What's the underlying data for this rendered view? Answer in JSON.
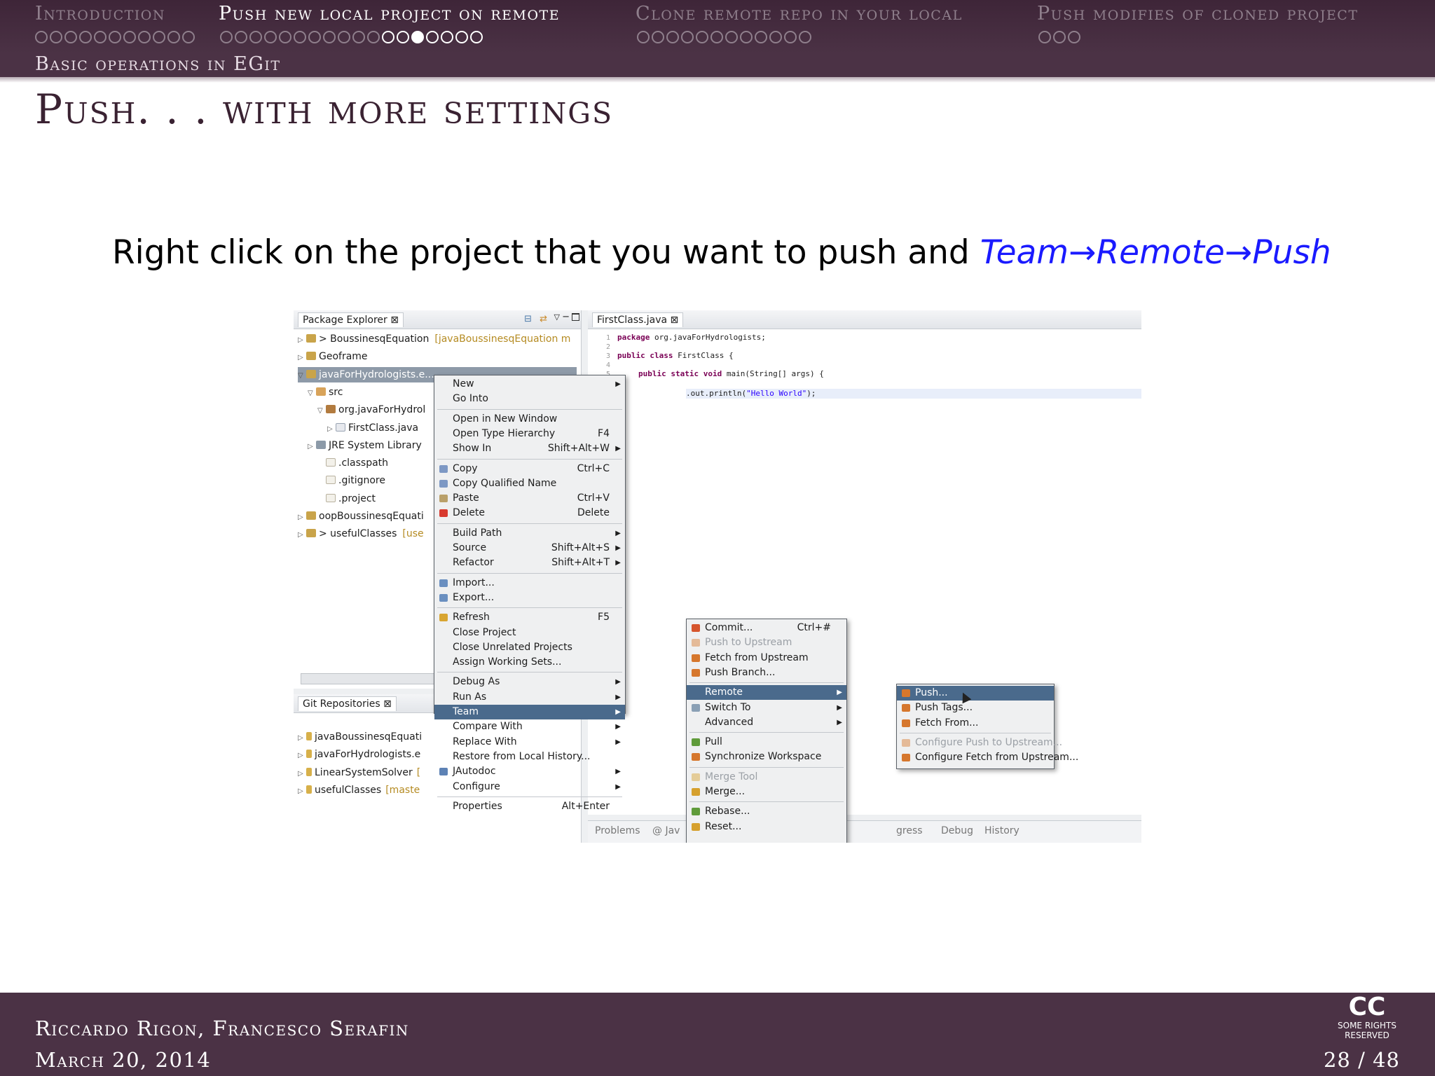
{
  "nav": {
    "sections": [
      {
        "label": "Introduction",
        "dots": 11,
        "filled": 0,
        "current": -1
      },
      {
        "label": "Push new local project on remote",
        "dots": 18,
        "filled": 7,
        "current": 13
      },
      {
        "label": "Clone remote repo in your local",
        "dots": 12,
        "filled": 0,
        "current": -1
      },
      {
        "label": "Push modifies of cloned project",
        "dots": 3,
        "filled": 0,
        "current": -1
      }
    ],
    "subsection": "Basic operations in EGit"
  },
  "frame_title": "Push. . . with more settings",
  "body": {
    "prefix": "Right click on the project that you want to push and ",
    "highlight": "Team→Remote→Push"
  },
  "eclipse": {
    "package_explorer": {
      "title": "Package Explorer ⊠",
      "items": [
        {
          "label": "> BoussinesqEquation",
          "extra": "[javaBoussinesqEquation m",
          "icon": "project-icon"
        },
        {
          "label": "Geoframe",
          "extra": "",
          "icon": "project-icon"
        },
        {
          "label": "javaForHydrologists.e...",
          "extra": "",
          "icon": "project-icon"
        },
        {
          "label": "src",
          "extra": "",
          "icon": "src-folder-icon"
        },
        {
          "label": "org.javaForHydrol",
          "extra": "",
          "icon": "package-icon"
        },
        {
          "label": "FirstClass.java",
          "extra": "",
          "icon": "java-file-icon"
        },
        {
          "label": "JRE System Library",
          "extra": "",
          "icon": "library-icon"
        },
        {
          "label": ".classpath",
          "extra": "",
          "icon": "file-icon"
        },
        {
          "label": ".gitignore",
          "extra": "",
          "icon": "file-icon"
        },
        {
          "label": ".project",
          "extra": "",
          "icon": "file-icon"
        },
        {
          "label": "oopBoussinesqEquati",
          "extra": "",
          "icon": "project-icon"
        },
        {
          "label": "> usefulClasses",
          "extra": "[use",
          "icon": "project-icon"
        }
      ]
    },
    "git_repositories": {
      "title": "Git Repositories ⊠",
      "items": [
        {
          "label": "javaBoussinesqEquati",
          "extra": ""
        },
        {
          "label": "javaForHydrologists.e",
          "extra": ""
        },
        {
          "label": "LinearSystemSolver",
          "extra": "["
        },
        {
          "label": "usefulClasses",
          "extra": "[maste"
        }
      ]
    },
    "editor": {
      "tab": "FirstClass.java ⊠",
      "lines": [
        {
          "n": "1",
          "kw": "package",
          "rest": " org.javaForHydrologists;",
          "str": ""
        },
        {
          "n": "2",
          "kw": "",
          "rest": "",
          "str": ""
        },
        {
          "n": "3",
          "kw": "public class",
          "rest": " FirstClass {",
          "str": ""
        },
        {
          "n": "4",
          "kw": "",
          "rest": "",
          "str": ""
        },
        {
          "n": "5",
          "kw": "public static void",
          "rest": " main(String[] args) {",
          "str": ""
        },
        {
          "n": "",
          "kw": "",
          "rest": "",
          "str": ""
        },
        {
          "n": "",
          "kw": "",
          "rest": ".out.println(",
          "str": "\"Hello World\"",
          "tail": ");"
        }
      ]
    },
    "bottom_views": [
      "Problems",
      "@ Jav",
      "gress",
      "Debug",
      "History"
    ],
    "context_menu": [
      {
        "label": "New",
        "sc": "",
        "arrow": true
      },
      {
        "label": "Go Into",
        "sc": ""
      },
      {
        "sep": true
      },
      {
        "label": "Open in New Window",
        "sc": ""
      },
      {
        "label": "Open Type Hierarchy",
        "sc": "F4"
      },
      {
        "label": "Show In",
        "sc": "Shift+Alt+W",
        "arrow": true
      },
      {
        "sep": true
      },
      {
        "label": "Copy",
        "sc": "Ctrl+C",
        "icon": "copy-icon"
      },
      {
        "label": "Copy Qualified Name",
        "sc": "",
        "icon": "copy-icon"
      },
      {
        "label": "Paste",
        "sc": "Ctrl+V",
        "icon": "paste-icon"
      },
      {
        "label": "Delete",
        "sc": "Delete",
        "icon": "delete-icon"
      },
      {
        "sep": true
      },
      {
        "label": "Build Path",
        "sc": "",
        "arrow": true
      },
      {
        "label": "Source",
        "sc": "Shift+Alt+S",
        "arrow": true
      },
      {
        "label": "Refactor",
        "sc": "Shift+Alt+T",
        "arrow": true
      },
      {
        "sep": true
      },
      {
        "label": "Import...",
        "sc": "",
        "icon": "import-icon"
      },
      {
        "label": "Export...",
        "sc": "",
        "icon": "export-icon"
      },
      {
        "sep": true
      },
      {
        "label": "Refresh",
        "sc": "F5",
        "icon": "refresh-icon"
      },
      {
        "label": "Close Project",
        "sc": ""
      },
      {
        "label": "Close Unrelated Projects",
        "sc": ""
      },
      {
        "label": "Assign Working Sets...",
        "sc": ""
      },
      {
        "sep": true
      },
      {
        "label": "Debug As",
        "sc": "",
        "arrow": true
      },
      {
        "label": "Run As",
        "sc": "",
        "arrow": true
      },
      {
        "label": "Team",
        "sc": "",
        "arrow": true,
        "hl": true
      },
      {
        "label": "Compare With",
        "sc": "",
        "arrow": true
      },
      {
        "label": "Replace With",
        "sc": "",
        "arrow": true
      },
      {
        "label": "Restore from Local History...",
        "sc": ""
      },
      {
        "label": "JAutodoc",
        "sc": "",
        "arrow": true,
        "icon": "jautodoc-icon"
      },
      {
        "label": "Configure",
        "sc": "",
        "arrow": true
      },
      {
        "sep": true
      },
      {
        "label": "Properties",
        "sc": "Alt+Enter"
      }
    ],
    "team_menu": [
      {
        "label": "Commit...",
        "sc": "Ctrl+#",
        "icon": "commit-icon"
      },
      {
        "label": "Push to Upstream",
        "sc": "",
        "dis": true,
        "icon": "push-icon"
      },
      {
        "label": "Fetch from Upstream",
        "sc": "",
        "icon": "fetch-icon"
      },
      {
        "label": "Push Branch...",
        "sc": "",
        "icon": "push-icon"
      },
      {
        "sep": true
      },
      {
        "label": "Remote",
        "sc": "",
        "arrow": true,
        "hl": true
      },
      {
        "label": "Switch To",
        "sc": "",
        "arrow": true,
        "icon": "switch-icon"
      },
      {
        "label": "Advanced",
        "sc": "",
        "arrow": true
      },
      {
        "sep": true
      },
      {
        "label": "Pull",
        "sc": "",
        "icon": "pull-icon"
      },
      {
        "label": "Synchronize Workspace",
        "sc": "",
        "icon": "sync-icon"
      },
      {
        "sep": true
      },
      {
        "label": "Merge Tool",
        "sc": "",
        "dis": true,
        "icon": "merge-icon"
      },
      {
        "label": "Merge...",
        "sc": "",
        "icon": "merge-icon"
      },
      {
        "sep": true
      },
      {
        "label": "Rebase...",
        "sc": "",
        "icon": "rebase-icon"
      },
      {
        "label": "Reset...",
        "sc": "",
        "icon": "reset-icon"
      }
    ],
    "remote_menu": [
      {
        "label": "Push...",
        "sc": "",
        "hl": true,
        "icon": "push-icon"
      },
      {
        "label": "Push Tags...",
        "sc": "",
        "icon": "push-icon"
      },
      {
        "label": "Fetch From...",
        "sc": "",
        "icon": "fetch-icon"
      },
      {
        "sep": true
      },
      {
        "label": "Configure Push to Upstream...",
        "sc": "",
        "dis": true,
        "icon": "config-icon"
      },
      {
        "label": "Configure Fetch from Upstream...",
        "sc": "",
        "icon": "config-icon"
      }
    ]
  },
  "footer": {
    "authors": "Riccardo Rigon, Francesco Serafin",
    "date": "March 20, 2014",
    "page": "28 / 48",
    "cc_big": "CC",
    "cc_small": "SOME RIGHTS RESERVED"
  },
  "colors": {
    "bar": "#4b3245",
    "link": "#1a1aff",
    "menu_highlight": "#4a6a8c"
  }
}
